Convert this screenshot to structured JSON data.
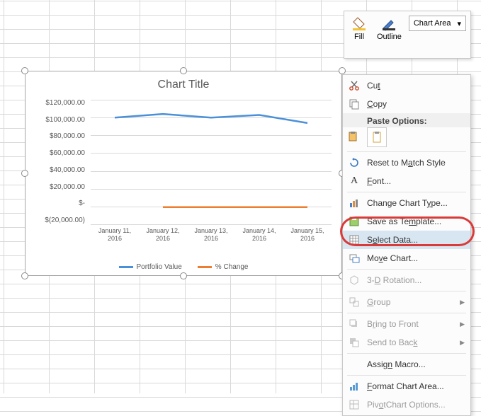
{
  "toolbar": {
    "fill": "Fill",
    "outline": "Outline",
    "selector": "Chart Area"
  },
  "chart_data": {
    "type": "line",
    "title": "Chart Title",
    "categories": [
      "January 11, 2016",
      "January 12, 2016",
      "January 13, 2016",
      "January 14, 2016",
      "January 15, 2016"
    ],
    "series": [
      {
        "name": "Portfolio Value",
        "color": "#4a90d9",
        "values": [
          100000,
          104000,
          100000,
          103000,
          94000
        ]
      },
      {
        "name": "% Change",
        "color": "#ed7d31",
        "values": [
          null,
          0,
          0,
          0,
          0
        ]
      }
    ],
    "ylim": [
      -20000,
      120000
    ],
    "ystep": 20000,
    "yticks": [
      "$120,000.00",
      "$100,000.00",
      "$80,000.00",
      "$60,000.00",
      "$40,000.00",
      "$20,000.00",
      "$-",
      "$(20,000.00)"
    ],
    "xlabel": "",
    "ylabel": ""
  },
  "legend": {
    "s0": "Portfolio Value",
    "s1": "% Change"
  },
  "menu": {
    "cut": "Cut",
    "copy": "Copy",
    "paste_options": "Paste Options:",
    "reset": "Reset to Match Style",
    "font": "Font...",
    "change_type": "Change Chart Type...",
    "save_tpl": "Save as Template...",
    "select_data": "Select Data...",
    "move_chart": "Move Chart...",
    "rotation": "3-D Rotation...",
    "group": "Group",
    "bring_front": "Bring to Front",
    "send_back": "Send to Back",
    "assign_macro": "Assign Macro...",
    "format_area": "Format Chart Area...",
    "pivot_opts": "PivotChart Options..."
  }
}
